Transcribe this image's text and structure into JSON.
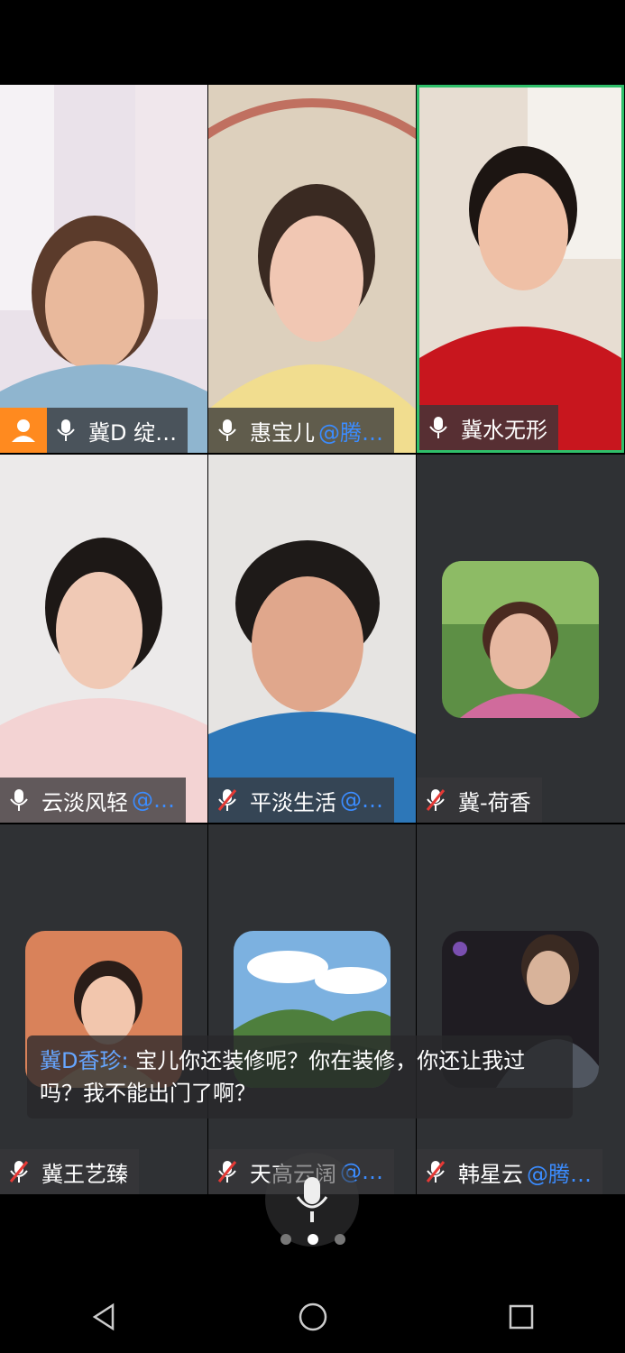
{
  "participants": [
    {
      "name": "冀D 绽…",
      "org": "",
      "mic": "on",
      "host": true
    },
    {
      "name": "惠宝儿",
      "org": "@腾…",
      "mic": "on"
    },
    {
      "name": "冀水无形",
      "org": "",
      "mic": "on",
      "active": true
    },
    {
      "name": "云淡风轻",
      "org": "@…",
      "mic": "on"
    },
    {
      "name": "平淡生活",
      "org": "@…",
      "mic": "muted"
    },
    {
      "name": "冀-荷香",
      "org": "",
      "mic": "muted"
    },
    {
      "name": "冀王艺臻",
      "org": "",
      "mic": "muted"
    },
    {
      "name": "天高云阔",
      "org": "@…",
      "mic": "muted"
    },
    {
      "name": "韩星云",
      "org": "@腾…",
      "mic": "muted"
    }
  ],
  "chat": {
    "sender": "冀D香珍:",
    "message": " 宝儿你还装修呢？你在装修，你还让我过吗？我不能出门了啊？"
  },
  "pager": {
    "pages": 3,
    "current": 2
  },
  "colors": {
    "accent": "#2fbf6a",
    "host": "#ff8a1f",
    "org": "#3b8cff"
  },
  "nav": {
    "icons": [
      "back-icon",
      "home-icon",
      "recents-icon"
    ]
  }
}
